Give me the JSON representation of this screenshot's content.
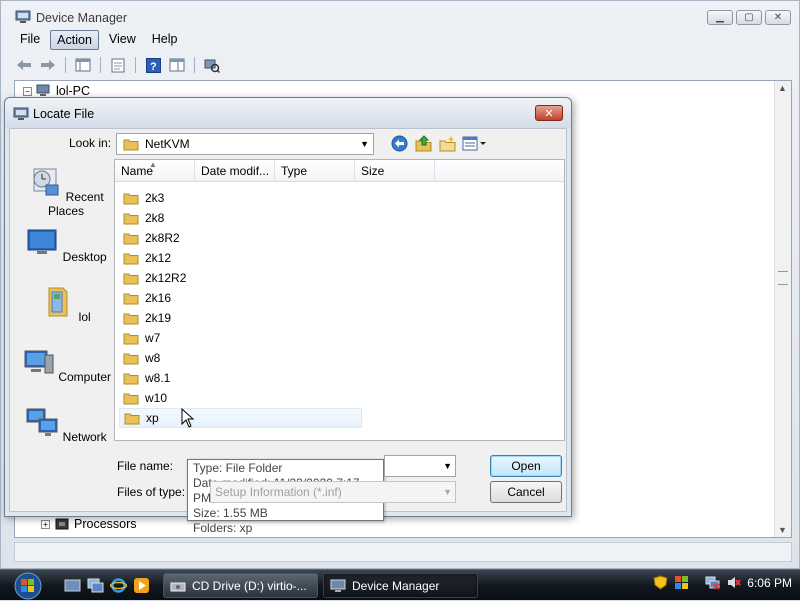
{
  "device_manager": {
    "title": "Device Manager",
    "menu": [
      "File",
      "Action",
      "View",
      "Help"
    ],
    "active_menu_index": 1,
    "tree": {
      "root": "lol-PC",
      "visible_bottom_item": "Processors"
    }
  },
  "dialog": {
    "title": "Locate File",
    "look_in_label": "Look in:",
    "look_in_value": "NetKVM",
    "places": [
      "Recent Places",
      "Desktop",
      "lol",
      "Computer",
      "Network"
    ],
    "columns": [
      "Name",
      "Date modif...",
      "Type",
      "Size"
    ],
    "folders": [
      "2k3",
      "2k8",
      "2k8R2",
      "2k12",
      "2k12R2",
      "2k16",
      "2k19",
      "w7",
      "w8",
      "w8.1",
      "w10",
      "xp"
    ],
    "hovered_folder_index": 11,
    "tooltip": {
      "type": "Type: File Folder",
      "date": "Date modified: 11/23/2020 7:17 PM",
      "size": "Size: 1.55 MB",
      "folders": "Folders: xp"
    },
    "file_name_label": "File name:",
    "file_name_value": "",
    "files_of_type_label": "Files of type:",
    "files_of_type_value": "Setup Information (*.inf)",
    "open_label": "Open",
    "cancel_label": "Cancel"
  },
  "taskbar": {
    "tasks": [
      "CD Drive (D:) virtio-...",
      "Device Manager"
    ],
    "active_task_index": 1,
    "clock": "6:06 PM"
  },
  "colors": {
    "folder_yellow": "#e8c15a",
    "accent_blue": "#3c7fb1",
    "close_red": "#c2402a"
  }
}
